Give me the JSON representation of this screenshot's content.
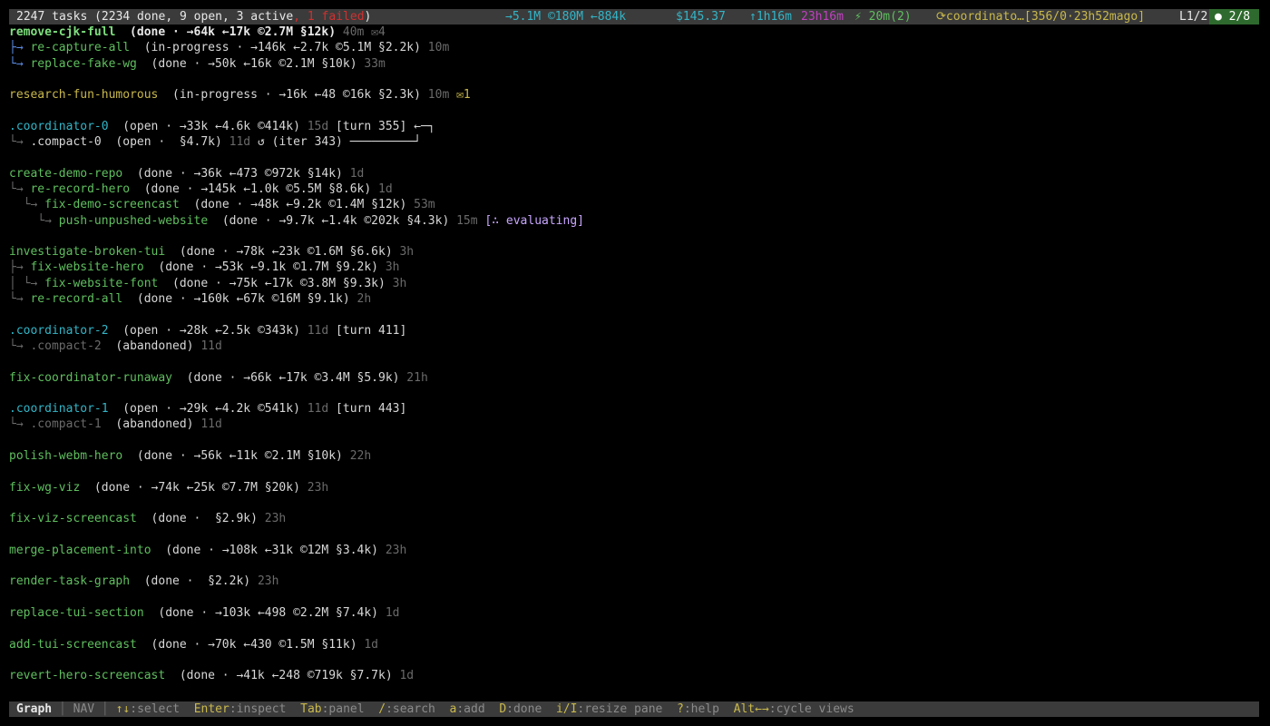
{
  "top_bar": {
    "summary": "2247 tasks (2234 done, 9 open, 3 active",
    "failed": ", 1 failed",
    "summary_close": ")",
    "tokens": "→5.1M ©180M ←884k",
    "cost": "$145.37",
    "uptime": "↑1h16m",
    "idle": "23h16m",
    "agents": "⚡ 20m(2)",
    "coordinator": "⟳coordinato…[356/0·23h52mago]",
    "pane": "L1/2",
    "agent_count": "● 2/8"
  },
  "tasks": [
    {
      "segments": [
        {
          "text": "remove-cjk-full",
          "cls": "c-greenb"
        },
        {
          "text": "  (done · →64k ←17k ©2.7M §12k)",
          "cls": "c-white c-bold"
        },
        {
          "text": " 40m ✉4",
          "cls": "c-dim"
        }
      ]
    },
    {
      "segments": [
        {
          "text": "├→ ",
          "cls": "c-tree"
        },
        {
          "text": "re-capture-all",
          "cls": "c-green"
        },
        {
          "text": "  (in-progress · →146k ←2.7k ©5.1M §2.2k)",
          "cls": "c-light"
        },
        {
          "text": " 10m",
          "cls": "c-dim"
        }
      ]
    },
    {
      "segments": [
        {
          "text": "└→ ",
          "cls": "c-tree"
        },
        {
          "text": "replace-fake-wg",
          "cls": "c-green"
        },
        {
          "text": "  (done · →50k ←16k ©2.1M §10k)",
          "cls": "c-light"
        },
        {
          "text": " 33m",
          "cls": "c-dim"
        }
      ]
    },
    {
      "segments": []
    },
    {
      "segments": [
        {
          "text": "research-fun-humorous",
          "cls": "c-yellow"
        },
        {
          "text": "  (in-progress · →16k ←48 ©16k §2.3k)",
          "cls": "c-light"
        },
        {
          "text": " 10m",
          "cls": "c-dim"
        },
        {
          "text": " ✉1",
          "cls": "c-yellow"
        }
      ]
    },
    {
      "segments": []
    },
    {
      "segments": [
        {
          "text": ".coordinator-0",
          "cls": "c-cyan"
        },
        {
          "text": "  (open · →33k ←4.6k ©414k)",
          "cls": "c-light"
        },
        {
          "text": " 15d",
          "cls": "c-dim"
        },
        {
          "text": " [turn 355] ←─┐",
          "cls": "c-light"
        }
      ]
    },
    {
      "segments": [
        {
          "text": "└→ ",
          "cls": "c-dim"
        },
        {
          "text": ".compact-0",
          "cls": "c-light"
        },
        {
          "text": "  (open ·  §4.7k)",
          "cls": "c-light"
        },
        {
          "text": " 11d",
          "cls": "c-dim"
        },
        {
          "text": " ↺ (iter 343) ─────────┘",
          "cls": "c-light"
        }
      ]
    },
    {
      "segments": []
    },
    {
      "segments": [
        {
          "text": "create-demo-repo",
          "cls": "c-green"
        },
        {
          "text": "  (done · →36k ←473 ©972k §14k)",
          "cls": "c-light"
        },
        {
          "text": " 1d",
          "cls": "c-dim"
        }
      ]
    },
    {
      "segments": [
        {
          "text": "└→ ",
          "cls": "c-dim"
        },
        {
          "text": "re-record-hero",
          "cls": "c-green"
        },
        {
          "text": "  (done · →145k ←1.0k ©5.5M §8.6k)",
          "cls": "c-light"
        },
        {
          "text": " 1d",
          "cls": "c-dim"
        }
      ]
    },
    {
      "segments": [
        {
          "text": "  └→ ",
          "cls": "c-dim"
        },
        {
          "text": "fix-demo-screencast",
          "cls": "c-green"
        },
        {
          "text": "  (done · →48k ←9.2k ©1.4M §12k)",
          "cls": "c-light"
        },
        {
          "text": " 53m",
          "cls": "c-dim"
        }
      ]
    },
    {
      "segments": [
        {
          "text": "    └→ ",
          "cls": "c-dim"
        },
        {
          "text": "push-unpushed-website",
          "cls": "c-green"
        },
        {
          "text": "  (done · →9.7k ←1.4k ©202k §4.3k)",
          "cls": "c-light"
        },
        {
          "text": " 15m",
          "cls": "c-dim"
        },
        {
          "text": " [∴ evaluating]",
          "cls": "c-purple"
        }
      ]
    },
    {
      "segments": []
    },
    {
      "segments": [
        {
          "text": "investigate-broken-tui",
          "cls": "c-green"
        },
        {
          "text": "  (done · →78k ←23k ©1.6M §6.6k)",
          "cls": "c-light"
        },
        {
          "text": " 3h",
          "cls": "c-dim"
        }
      ]
    },
    {
      "segments": [
        {
          "text": "├→ ",
          "cls": "c-dim"
        },
        {
          "text": "fix-website-hero",
          "cls": "c-green"
        },
        {
          "text": "  (done · →53k ←9.1k ©1.7M §9.2k)",
          "cls": "c-light"
        },
        {
          "text": " 3h",
          "cls": "c-dim"
        }
      ]
    },
    {
      "segments": [
        {
          "text": "│ └→ ",
          "cls": "c-dim"
        },
        {
          "text": "fix-website-font",
          "cls": "c-green"
        },
        {
          "text": "  (done · →75k ←17k ©3.8M §9.3k)",
          "cls": "c-light"
        },
        {
          "text": " 3h",
          "cls": "c-dim"
        }
      ]
    },
    {
      "segments": [
        {
          "text": "└→ ",
          "cls": "c-dim"
        },
        {
          "text": "re-record-all",
          "cls": "c-green"
        },
        {
          "text": "  (done · →160k ←67k ©16M §9.1k)",
          "cls": "c-light"
        },
        {
          "text": " 2h",
          "cls": "c-dim"
        }
      ]
    },
    {
      "segments": []
    },
    {
      "segments": [
        {
          "text": ".coordinator-2",
          "cls": "c-cyan"
        },
        {
          "text": "  (open · →28k ←2.5k ©343k)",
          "cls": "c-light"
        },
        {
          "text": " 11d",
          "cls": "c-dim"
        },
        {
          "text": " [turn 411]",
          "cls": "c-light"
        }
      ]
    },
    {
      "segments": [
        {
          "text": "└→ ",
          "cls": "c-dim"
        },
        {
          "text": ".compact-2",
          "cls": "c-dim"
        },
        {
          "text": "  (abandoned)",
          "cls": "c-light"
        },
        {
          "text": " 11d",
          "cls": "c-dim"
        }
      ]
    },
    {
      "segments": []
    },
    {
      "segments": [
        {
          "text": "fix-coordinator-runaway",
          "cls": "c-green"
        },
        {
          "text": "  (done · →66k ←17k ©3.4M §5.9k)",
          "cls": "c-light"
        },
        {
          "text": " 21h",
          "cls": "c-dim"
        }
      ]
    },
    {
      "segments": []
    },
    {
      "segments": [
        {
          "text": ".coordinator-1",
          "cls": "c-cyan"
        },
        {
          "text": "  (open · →29k ←4.2k ©541k)",
          "cls": "c-light"
        },
        {
          "text": " 11d",
          "cls": "c-dim"
        },
        {
          "text": " [turn 443]",
          "cls": "c-light"
        }
      ]
    },
    {
      "segments": [
        {
          "text": "└→ ",
          "cls": "c-dim"
        },
        {
          "text": ".compact-1",
          "cls": "c-dim"
        },
        {
          "text": "  (abandoned)",
          "cls": "c-light"
        },
        {
          "text": " 11d",
          "cls": "c-dim"
        }
      ]
    },
    {
      "segments": []
    },
    {
      "segments": [
        {
          "text": "polish-webm-hero",
          "cls": "c-green"
        },
        {
          "text": "  (done · →56k ←11k ©2.1M §10k)",
          "cls": "c-light"
        },
        {
          "text": " 22h",
          "cls": "c-dim"
        }
      ]
    },
    {
      "segments": []
    },
    {
      "segments": [
        {
          "text": "fix-wg-viz",
          "cls": "c-green"
        },
        {
          "text": "  (done · →74k ←25k ©7.7M §20k)",
          "cls": "c-light"
        },
        {
          "text": " 23h",
          "cls": "c-dim"
        }
      ]
    },
    {
      "segments": []
    },
    {
      "segments": [
        {
          "text": "fix-viz-screencast",
          "cls": "c-green"
        },
        {
          "text": "  (done ·  §2.9k)",
          "cls": "c-light"
        },
        {
          "text": " 23h",
          "cls": "c-dim"
        }
      ]
    },
    {
      "segments": []
    },
    {
      "segments": [
        {
          "text": "merge-placement-into",
          "cls": "c-green"
        },
        {
          "text": "  (done · →108k ←31k ©12M §3.4k)",
          "cls": "c-light"
        },
        {
          "text": " 23h",
          "cls": "c-dim"
        }
      ]
    },
    {
      "segments": []
    },
    {
      "segments": [
        {
          "text": "render-task-graph",
          "cls": "c-green"
        },
        {
          "text": "  (done ·  §2.2k)",
          "cls": "c-light"
        },
        {
          "text": " 23h",
          "cls": "c-dim"
        }
      ]
    },
    {
      "segments": []
    },
    {
      "segments": [
        {
          "text": "replace-tui-section",
          "cls": "c-green"
        },
        {
          "text": "  (done · →103k ←498 ©2.2M §7.4k)",
          "cls": "c-light"
        },
        {
          "text": " 1d",
          "cls": "c-dim"
        }
      ]
    },
    {
      "segments": []
    },
    {
      "segments": [
        {
          "text": "add-tui-screencast",
          "cls": "c-green"
        },
        {
          "text": "  (done · →70k ←430 ©1.5M §11k)",
          "cls": "c-light"
        },
        {
          "text": " 1d",
          "cls": "c-dim"
        }
      ]
    },
    {
      "segments": []
    },
    {
      "segments": [
        {
          "text": "revert-hero-screencast",
          "cls": "c-green"
        },
        {
          "text": "  (done · →41k ←248 ©719k §7.7k)",
          "cls": "c-light"
        },
        {
          "text": " 1d",
          "cls": "c-dim"
        }
      ]
    }
  ],
  "bottom_bar": {
    "mode": "Graph",
    "nav": "NAV",
    "keys": [
      {
        "key": "↑↓",
        "label": ":select"
      },
      {
        "key": "Enter",
        "label": ":inspect"
      },
      {
        "key": "Tab",
        "label": ":panel"
      },
      {
        "key": "/",
        "label": ":search"
      },
      {
        "key": "a",
        "label": ":add"
      },
      {
        "key": "D",
        "label": ":done"
      },
      {
        "key": "i/I",
        "label": ":resize pane"
      },
      {
        "key": "?",
        "label": ":help"
      },
      {
        "key": "Alt←→",
        "label": ":cycle views"
      }
    ]
  },
  "colors": {
    "background": "#000000",
    "bar": "#3b3b3b",
    "done_green": "#5fbf5f",
    "coordinator_cyan": "#33b5c7",
    "in_progress_yellow": "#c9b84c",
    "failed_red": "#d03030"
  }
}
